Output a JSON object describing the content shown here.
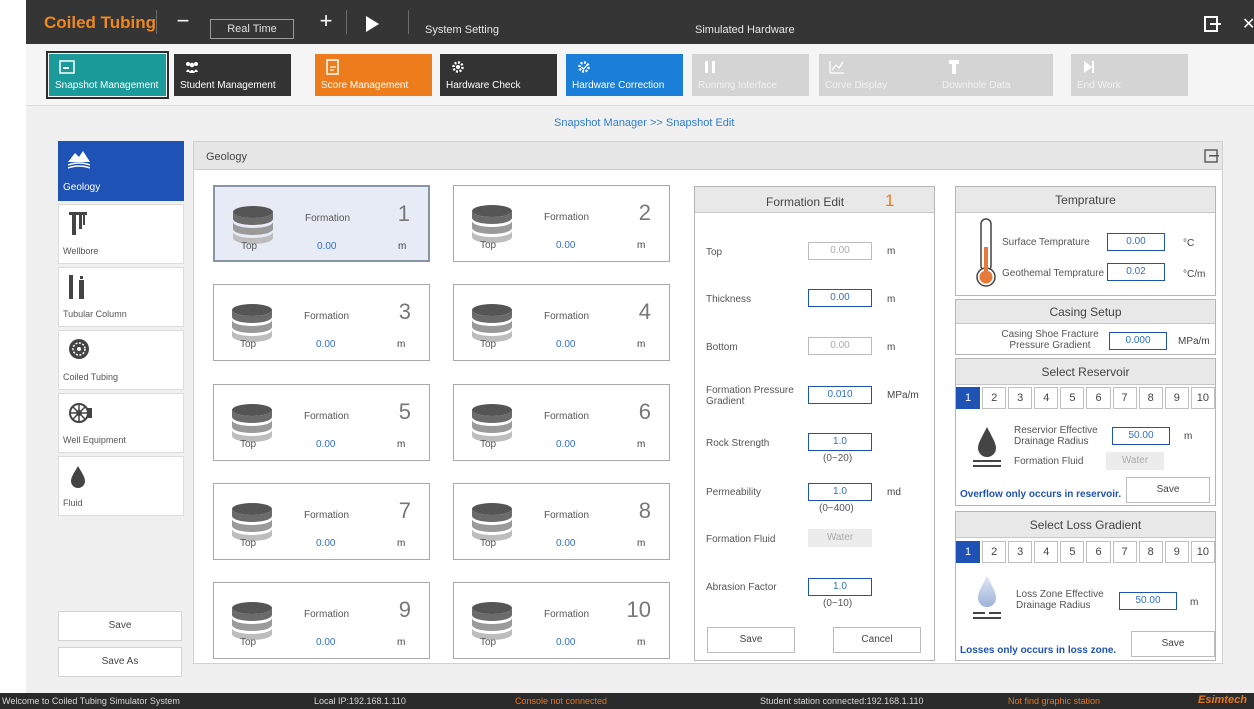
{
  "titlebar": {
    "app_title": "Coiled Tubing",
    "realtime": "Real Time",
    "system_setting": "System Setting",
    "simulated_hardware": "Simulated Hardware"
  },
  "toolbar": {
    "buttons": [
      {
        "label": "Snapshot Management",
        "state": "active"
      },
      {
        "label": "Student Management",
        "state": "dark"
      },
      {
        "label": "Score Management",
        "state": "orange"
      },
      {
        "label": "Hardware Check",
        "state": "dark"
      },
      {
        "label": "Hardware Correction",
        "state": "blue"
      },
      {
        "label": "Running Interface",
        "state": "disabled"
      },
      {
        "label": "Curve Display",
        "state": "disabled"
      },
      {
        "label": "Downhole Data",
        "state": "disabled"
      },
      {
        "label": "End Work",
        "state": "disabled"
      }
    ]
  },
  "breadcrumb": "Snapshot Manager >> Snapshot Edit",
  "nav": {
    "items": [
      {
        "label": "Geology"
      },
      {
        "label": "Wellbore"
      },
      {
        "label": "Tubular Column"
      },
      {
        "label": "Coiled Tubing"
      },
      {
        "label": "Well Equipment"
      },
      {
        "label": "Fluid"
      }
    ],
    "save": "Save",
    "save_as": "Save As"
  },
  "geology": {
    "title": "Geology",
    "formations": [
      {
        "name": "Formation",
        "number": "1",
        "top_label": "Top",
        "top_value": "0.00",
        "unit": "m"
      },
      {
        "name": "Formation",
        "number": "2",
        "top_label": "Top",
        "top_value": "0.00",
        "unit": "m"
      },
      {
        "name": "Formation",
        "number": "3",
        "top_label": "Top",
        "top_value": "0.00",
        "unit": "m"
      },
      {
        "name": "Formation",
        "number": "4",
        "top_label": "Top",
        "top_value": "0.00",
        "unit": "m"
      },
      {
        "name": "Formation",
        "number": "5",
        "top_label": "Top",
        "top_value": "0.00",
        "unit": "m"
      },
      {
        "name": "Formation",
        "number": "6",
        "top_label": "Top",
        "top_value": "0.00",
        "unit": "m"
      },
      {
        "name": "Formation",
        "number": "7",
        "top_label": "Top",
        "top_value": "0.00",
        "unit": "m"
      },
      {
        "name": "Formation",
        "number": "8",
        "top_label": "Top",
        "top_value": "0.00",
        "unit": "m"
      },
      {
        "name": "Formation",
        "number": "9",
        "top_label": "Top",
        "top_value": "0.00",
        "unit": "m"
      },
      {
        "name": "Formation",
        "number": "10",
        "top_label": "Top",
        "top_value": "0.00",
        "unit": "m"
      }
    ]
  },
  "formation_edit": {
    "title": "Formation Edit",
    "number": "1",
    "top": {
      "label": "Top",
      "value": "0.00",
      "unit": "m"
    },
    "thickness": {
      "label": "Thickness",
      "value": "0.00",
      "unit": "m"
    },
    "bottom": {
      "label": "Bottom",
      "value": "0.00",
      "unit": "m"
    },
    "pressure_gradient": {
      "label": "Formation Pressure Gradient",
      "value": "0.010",
      "unit": "MPa/m"
    },
    "rock_strength": {
      "label": "Rock Strength",
      "value": "1.0",
      "range": "(0~20)"
    },
    "permeability": {
      "label": "Permeability",
      "value": "1.0",
      "unit": "md",
      "range": "(0~400)"
    },
    "formation_fluid": {
      "label": "Formation Fluid",
      "value": "Water"
    },
    "abrasion_factor": {
      "label": "Abrasion Factor",
      "value": "1.0",
      "range": "(0~10)"
    },
    "save": "Save",
    "cancel": "Cancel"
  },
  "temperature": {
    "title": "Temprature",
    "surface_label": "Surface Temprature",
    "surface_value": "0.00",
    "surface_unit": "°C",
    "geothermal_label": "Geothemal Temprature",
    "geothermal_value": "0.02",
    "geothermal_unit": "°C/m"
  },
  "casing": {
    "title": "Casing Setup",
    "label": "Casing Shoe Fracture Pressure Gradient",
    "value": "0.000",
    "unit": "MPa/m"
  },
  "reservoir": {
    "title": "Select Reservoir",
    "numbers": [
      "1",
      "2",
      "3",
      "4",
      "5",
      "6",
      "7",
      "8",
      "9",
      "10"
    ],
    "radius_label": "Reservior Effective Drainage Radius",
    "radius_value": "50.00",
    "radius_unit": "m",
    "fluid_label": "Formation Fluid",
    "fluid_value": "Water",
    "note": "Overflow only occurs in reservoir.",
    "save": "Save"
  },
  "loss": {
    "title": "Select Loss Gradient",
    "numbers": [
      "1",
      "2",
      "3",
      "4",
      "5",
      "6",
      "7",
      "8",
      "9",
      "10"
    ],
    "radius_label": "Loss Zone Effective Drainage Radius",
    "radius_value": "50.00",
    "radius_unit": "m",
    "note": "Losses only occurs in loss zone.",
    "save": "Save"
  },
  "status": {
    "welcome": "Welcome to Coiled Tubing Simulator System",
    "local_ip": "Local IP:192.168.1.110",
    "console": "Console not connected",
    "student_station": "Student station connected:192.168.1.110",
    "graphic": "Not find graphic station",
    "brand": "Esimtech"
  },
  "colors": {
    "accent_orange": "#ed7d1c",
    "teal": "#1a9b9a",
    "blue": "#1b7fd8",
    "nav_active": "#1f52b5"
  }
}
